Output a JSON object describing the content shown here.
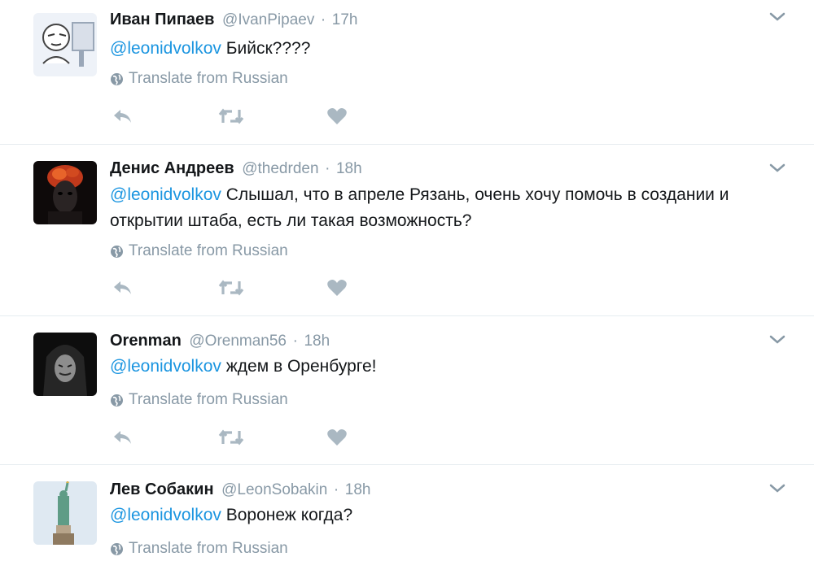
{
  "tweets": [
    {
      "name": "Иван Пипаев",
      "handle": "@IvanPipaev",
      "dot": "·",
      "time": "17h",
      "mention": "@leonidvolkov",
      "text": " Бийск????",
      "translate": "Translate from Russian"
    },
    {
      "name": "Денис Андреев",
      "handle": "@thedrden",
      "dot": "·",
      "time": "18h",
      "mention": "@leonidvolkov",
      "text": " Слышал, что в апреле Рязань, очень хочу помочь в создании и открытии штаба, есть ли такая возможность?",
      "translate": "Translate from Russian"
    },
    {
      "name": "Orenman",
      "handle": "@Orenman56",
      "dot": "·",
      "time": "18h",
      "mention": "@leonidvolkov",
      "text": " ждем в Оренбурге!",
      "translate": "Translate from Russian"
    },
    {
      "name": "Лев Собакин",
      "handle": "@LeonSobakin",
      "dot": "·",
      "time": "18h",
      "mention": "@leonidvolkov",
      "text": " Воронеж когда?",
      "translate": "Translate from Russian"
    }
  ],
  "icons": {
    "reply": "reply-icon",
    "retweet": "retweet-icon",
    "like": "heart-icon",
    "translate": "globe-icon",
    "menu": "chevron-down-icon"
  },
  "colors": {
    "text": "#14171a",
    "secondary": "#8899a6",
    "mention": "#1b95e0",
    "action_icon": "#aab8c2",
    "divider": "#e6ecf0"
  }
}
